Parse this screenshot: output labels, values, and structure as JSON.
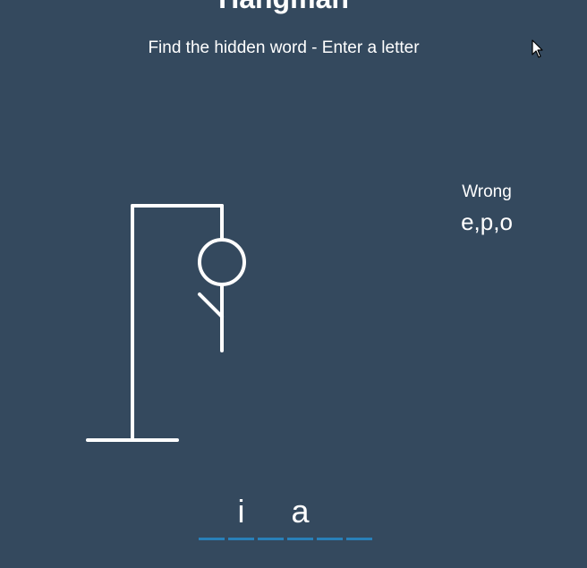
{
  "header": {
    "title": "Hangman",
    "subtitle": "Find the hidden word - Enter a letter"
  },
  "wrong": {
    "label": "Wrong",
    "letters": "e,p,o"
  },
  "word": {
    "slots": [
      "",
      "i",
      "",
      "a",
      "",
      ""
    ]
  },
  "figure": {
    "parts_shown": [
      "head",
      "body",
      "left-arm"
    ],
    "wrong_guess_count": 3
  },
  "colors": {
    "background": "#34495e",
    "foreground": "#ffffff",
    "underline": "#2980b9"
  },
  "icons": {
    "cursor": "mouse-pointer-icon"
  }
}
